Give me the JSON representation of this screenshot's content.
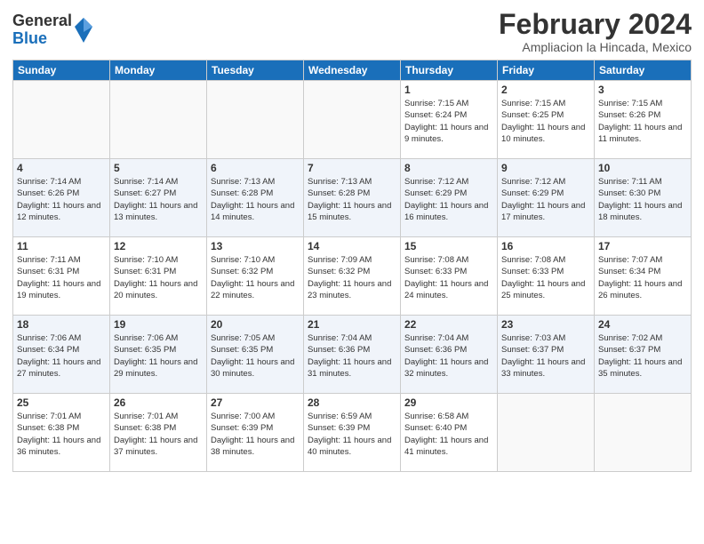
{
  "logo": {
    "general": "General",
    "blue": "Blue"
  },
  "title": "February 2024",
  "subtitle": "Ampliacion la Hincada, Mexico",
  "weekdays": [
    "Sunday",
    "Monday",
    "Tuesday",
    "Wednesday",
    "Thursday",
    "Friday",
    "Saturday"
  ],
  "weeks": [
    [
      {
        "day": "",
        "info": ""
      },
      {
        "day": "",
        "info": ""
      },
      {
        "day": "",
        "info": ""
      },
      {
        "day": "",
        "info": ""
      },
      {
        "day": "1",
        "info": "Sunrise: 7:15 AM\nSunset: 6:24 PM\nDaylight: 11 hours and 9 minutes."
      },
      {
        "day": "2",
        "info": "Sunrise: 7:15 AM\nSunset: 6:25 PM\nDaylight: 11 hours and 10 minutes."
      },
      {
        "day": "3",
        "info": "Sunrise: 7:15 AM\nSunset: 6:26 PM\nDaylight: 11 hours and 11 minutes."
      }
    ],
    [
      {
        "day": "4",
        "info": "Sunrise: 7:14 AM\nSunset: 6:26 PM\nDaylight: 11 hours and 12 minutes."
      },
      {
        "day": "5",
        "info": "Sunrise: 7:14 AM\nSunset: 6:27 PM\nDaylight: 11 hours and 13 minutes."
      },
      {
        "day": "6",
        "info": "Sunrise: 7:13 AM\nSunset: 6:28 PM\nDaylight: 11 hours and 14 minutes."
      },
      {
        "day": "7",
        "info": "Sunrise: 7:13 AM\nSunset: 6:28 PM\nDaylight: 11 hours and 15 minutes."
      },
      {
        "day": "8",
        "info": "Sunrise: 7:12 AM\nSunset: 6:29 PM\nDaylight: 11 hours and 16 minutes."
      },
      {
        "day": "9",
        "info": "Sunrise: 7:12 AM\nSunset: 6:29 PM\nDaylight: 11 hours and 17 minutes."
      },
      {
        "day": "10",
        "info": "Sunrise: 7:11 AM\nSunset: 6:30 PM\nDaylight: 11 hours and 18 minutes."
      }
    ],
    [
      {
        "day": "11",
        "info": "Sunrise: 7:11 AM\nSunset: 6:31 PM\nDaylight: 11 hours and 19 minutes."
      },
      {
        "day": "12",
        "info": "Sunrise: 7:10 AM\nSunset: 6:31 PM\nDaylight: 11 hours and 20 minutes."
      },
      {
        "day": "13",
        "info": "Sunrise: 7:10 AM\nSunset: 6:32 PM\nDaylight: 11 hours and 22 minutes."
      },
      {
        "day": "14",
        "info": "Sunrise: 7:09 AM\nSunset: 6:32 PM\nDaylight: 11 hours and 23 minutes."
      },
      {
        "day": "15",
        "info": "Sunrise: 7:08 AM\nSunset: 6:33 PM\nDaylight: 11 hours and 24 minutes."
      },
      {
        "day": "16",
        "info": "Sunrise: 7:08 AM\nSunset: 6:33 PM\nDaylight: 11 hours and 25 minutes."
      },
      {
        "day": "17",
        "info": "Sunrise: 7:07 AM\nSunset: 6:34 PM\nDaylight: 11 hours and 26 minutes."
      }
    ],
    [
      {
        "day": "18",
        "info": "Sunrise: 7:06 AM\nSunset: 6:34 PM\nDaylight: 11 hours and 27 minutes."
      },
      {
        "day": "19",
        "info": "Sunrise: 7:06 AM\nSunset: 6:35 PM\nDaylight: 11 hours and 29 minutes."
      },
      {
        "day": "20",
        "info": "Sunrise: 7:05 AM\nSunset: 6:35 PM\nDaylight: 11 hours and 30 minutes."
      },
      {
        "day": "21",
        "info": "Sunrise: 7:04 AM\nSunset: 6:36 PM\nDaylight: 11 hours and 31 minutes."
      },
      {
        "day": "22",
        "info": "Sunrise: 7:04 AM\nSunset: 6:36 PM\nDaylight: 11 hours and 32 minutes."
      },
      {
        "day": "23",
        "info": "Sunrise: 7:03 AM\nSunset: 6:37 PM\nDaylight: 11 hours and 33 minutes."
      },
      {
        "day": "24",
        "info": "Sunrise: 7:02 AM\nSunset: 6:37 PM\nDaylight: 11 hours and 35 minutes."
      }
    ],
    [
      {
        "day": "25",
        "info": "Sunrise: 7:01 AM\nSunset: 6:38 PM\nDaylight: 11 hours and 36 minutes."
      },
      {
        "day": "26",
        "info": "Sunrise: 7:01 AM\nSunset: 6:38 PM\nDaylight: 11 hours and 37 minutes."
      },
      {
        "day": "27",
        "info": "Sunrise: 7:00 AM\nSunset: 6:39 PM\nDaylight: 11 hours and 38 minutes."
      },
      {
        "day": "28",
        "info": "Sunrise: 6:59 AM\nSunset: 6:39 PM\nDaylight: 11 hours and 40 minutes."
      },
      {
        "day": "29",
        "info": "Sunrise: 6:58 AM\nSunset: 6:40 PM\nDaylight: 11 hours and 41 minutes."
      },
      {
        "day": "",
        "info": ""
      },
      {
        "day": "",
        "info": ""
      }
    ]
  ]
}
